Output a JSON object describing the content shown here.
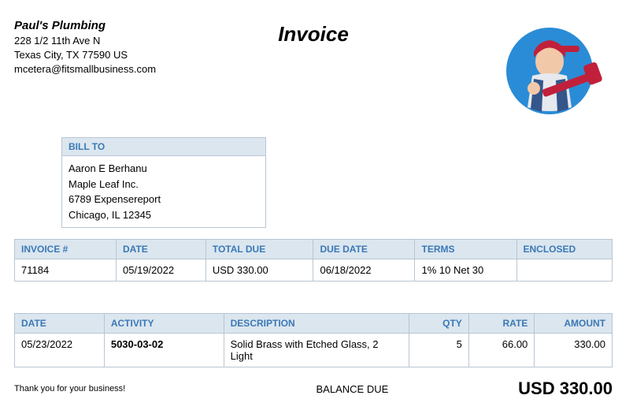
{
  "company": {
    "name": "Paul's Plumbing",
    "address1": "228 1/2 11th Ave N",
    "address2": "Texas City, TX  77590 US",
    "email": "mcetera@fitsmallbusiness.com"
  },
  "doc_title": "Invoice",
  "billto": {
    "header": "BILL TO",
    "name": "Aaron E Berhanu",
    "company": "Maple Leaf Inc.",
    "street": "6789 Expensereport",
    "citystate": "Chicago, IL  12345"
  },
  "meta": {
    "headers": {
      "invoice": "INVOICE #",
      "date": "DATE",
      "total_due": "TOTAL DUE",
      "due_date": "DUE DATE",
      "terms": "TERMS",
      "enclosed": "ENCLOSED"
    },
    "values": {
      "invoice": "71184",
      "date": "05/19/2022",
      "total_due": "USD 330.00",
      "due_date": "06/18/2022",
      "terms": "1% 10 Net 30",
      "enclosed": ""
    }
  },
  "items": {
    "headers": {
      "date": "DATE",
      "activity": "ACTIVITY",
      "description": "DESCRIPTION",
      "qty": "QTY",
      "rate": "RATE",
      "amount": "AMOUNT"
    },
    "rows": [
      {
        "date": "05/23/2022",
        "activity": "5030-03-02",
        "description": "Solid Brass with Etched Glass, 2 Light",
        "qty": "5",
        "rate": "66.00",
        "amount": "330.00"
      }
    ]
  },
  "footer": {
    "thankyou": "Thank you for your business!",
    "balance_label": "BALANCE DUE",
    "balance_amount": "USD 330.00"
  }
}
